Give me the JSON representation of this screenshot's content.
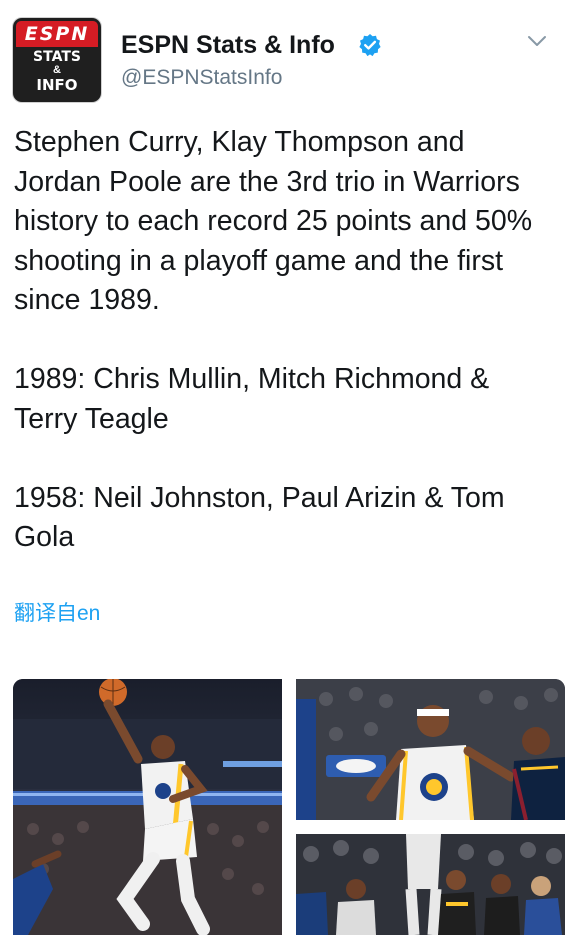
{
  "account": {
    "avatar_logo": "ESPN",
    "avatar_line1": "STATS",
    "avatar_line2": "&",
    "avatar_line3": "INFO",
    "display_name": "ESPN Stats & Info",
    "handle": "@ESPNStatsInfo",
    "verified_icon": "verified-badge-icon",
    "menu_icon": "chevron-down-icon"
  },
  "tweet": {
    "paragraph1": "Stephen Curry, Klay Thompson and Jordan Poole are the 3rd trio in Warriors history to each record 25 points and 50% shooting in a playoff game and the first since 1989.",
    "paragraph2": "1989: Chris Mullin, Mitch Richmond & Terry Teagle",
    "paragraph3": "1958: Neil Johnston, Paul Arizin & Tom Gola",
    "translate_link": "翻译自en"
  },
  "colors": {
    "link": "#1da1f2",
    "verified": "#1da1f2",
    "espn_red": "#d51c24",
    "warriors_gold": "#ffc72c",
    "warriors_blue": "#1d428a"
  }
}
